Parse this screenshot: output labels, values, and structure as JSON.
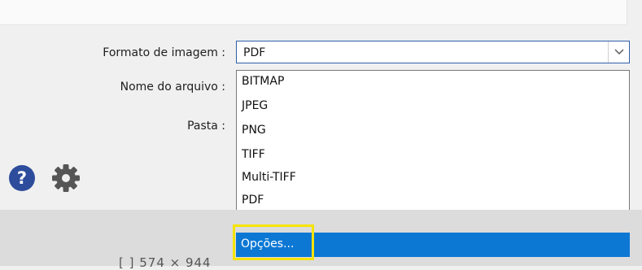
{
  "form": {
    "image_format_label": "Formato de imagem :",
    "filename_label": "Nome do arquivo :",
    "folder_label": "Pasta :",
    "image_format_value": "PDF"
  },
  "dropdown": {
    "options": [
      "BITMAP",
      "JPEG",
      "PNG",
      "TIFF",
      "Multi-TIFF",
      "PDF"
    ],
    "options_item": "Opções..."
  },
  "footer": {
    "dimensions_partial": "[ ]  574 × 944"
  },
  "icons": {
    "help": "help-icon",
    "settings": "gear-icon"
  },
  "colors": {
    "accent": "#0c78d4",
    "help_icon": "#2d4c9c",
    "gear_icon": "#555555",
    "highlight": "#f5e400"
  }
}
